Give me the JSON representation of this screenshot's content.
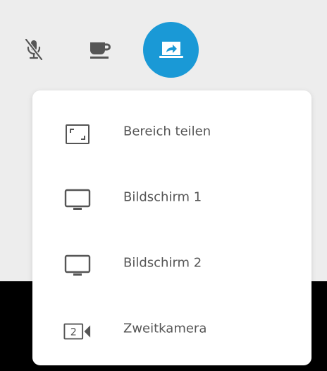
{
  "colors": {
    "toolbar_background": "#ededed",
    "video_background": "#000000",
    "share_button": "#1a99d6",
    "icon_color": "#555555",
    "menu_background": "#ffffff"
  },
  "toolbar": {
    "buttons": [
      {
        "icon": "mic-muted-icon",
        "active": false
      },
      {
        "icon": "coffee-cup-icon",
        "active": false
      },
      {
        "icon": "screen-share-icon",
        "active": true
      }
    ]
  },
  "share_menu": {
    "items": [
      {
        "icon": "region-select-icon",
        "label": "Bereich teilen"
      },
      {
        "icon": "monitor-icon",
        "label": "Bildschirm 1"
      },
      {
        "icon": "monitor-icon",
        "label": "Bildschirm 2"
      },
      {
        "icon": "second-camera-icon",
        "label": "Zweitkamera",
        "icon_text": "2"
      }
    ]
  }
}
